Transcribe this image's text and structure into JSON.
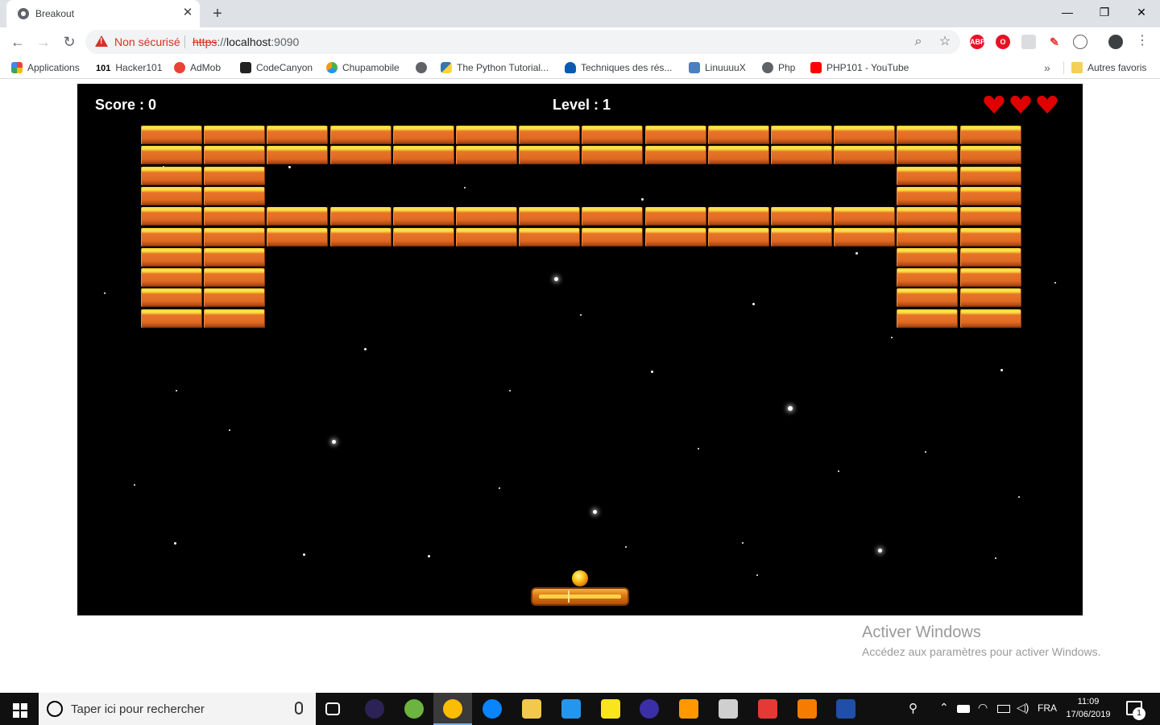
{
  "browser": {
    "tab": {
      "title": "Breakout",
      "close": "✕"
    },
    "new_tab": "+",
    "window": {
      "minimize": "—",
      "restore": "❐",
      "close": "✕"
    },
    "nav": {
      "back": "←",
      "forward": "→",
      "reload": "↻"
    },
    "omnibox": {
      "security_label": "Non sécurisé",
      "url_scheme": "https",
      "url_separator": "://",
      "url_host": "localhost",
      "url_port": ":9090"
    },
    "extensions": [
      "ABP",
      "O"
    ],
    "menu": "⋮"
  },
  "bookmarks": {
    "items": [
      {
        "label": "Applications",
        "icon": "apps-grid-icon",
        "color": "#e94235"
      },
      {
        "label": "Hacker101",
        "icon": "hacker101-icon",
        "prefix": "101",
        "color": "#000000"
      },
      {
        "label": "AdMob",
        "icon": "admob-icon",
        "color": "#ea4335"
      },
      {
        "label": "CodeCanyon",
        "icon": "codecanyon-icon",
        "color": "#222222"
      },
      {
        "label": "Chupamobile",
        "icon": "chupamobile-icon",
        "color": "#4caf50"
      },
      {
        "label": "",
        "icon": "globe-icon",
        "color": "#5f6368"
      },
      {
        "label": "The Python Tutorial...",
        "icon": "python-icon",
        "color": "#3776ab"
      },
      {
        "label": "Techniques des rés...",
        "icon": "onedrive-icon",
        "color": "#0a5ab4"
      },
      {
        "label": "LinuuuuX",
        "icon": "linux-icon",
        "color": "#4a7fc1"
      },
      {
        "label": "Php",
        "icon": "globe-icon",
        "color": "#5f6368"
      },
      {
        "label": "PHP101 - YouTube",
        "icon": "youtube-icon",
        "color": "#ff0000"
      }
    ],
    "overflow": "»",
    "other_folder": "Autres favoris"
  },
  "game": {
    "score_label": "Score : 0",
    "level_label": "Level : 1",
    "lives": 3,
    "heart_color": "#e00000",
    "brick_rows": [
      "11111111111111",
      "11111111111111",
      "11000000000011",
      "11000000000011",
      "11111111111111",
      "11111111111111",
      "11000000000011",
      "11000000000011",
      "11000000000011",
      "11000000000011"
    ]
  },
  "watermark": {
    "title": "Activer Windows",
    "subtitle": "Accédez aux paramètres pour activer Windows."
  },
  "taskbar": {
    "search_placeholder": "Taper ici pour rechercher",
    "language": "FRA",
    "time": "11:09",
    "date": "17/06/2019",
    "notification_count": "1",
    "apps": [
      {
        "name": "task-view",
        "color": "#ffffff"
      },
      {
        "name": "eclipse",
        "color": "#2c2255"
      },
      {
        "name": "spring-tools",
        "color": "#6db33f"
      },
      {
        "name": "chrome",
        "color": "#fbbc05"
      },
      {
        "name": "firefox",
        "color": "#0a84ff"
      },
      {
        "name": "file-explorer",
        "color": "#f2c94c"
      },
      {
        "name": "docker",
        "color": "#2496ed"
      },
      {
        "name": "sticky-notes",
        "color": "#f8e51b"
      },
      {
        "name": "eclipse-purple",
        "color": "#3b2fa8"
      },
      {
        "name": "sublime-text",
        "color": "#ff9800"
      },
      {
        "name": "paint",
        "color": "#cfcfcf"
      },
      {
        "name": "gmail-like",
        "color": "#e53935"
      },
      {
        "name": "grafana-like",
        "color": "#f57c00"
      },
      {
        "name": "powershell",
        "color": "#1f4fa8"
      }
    ]
  }
}
